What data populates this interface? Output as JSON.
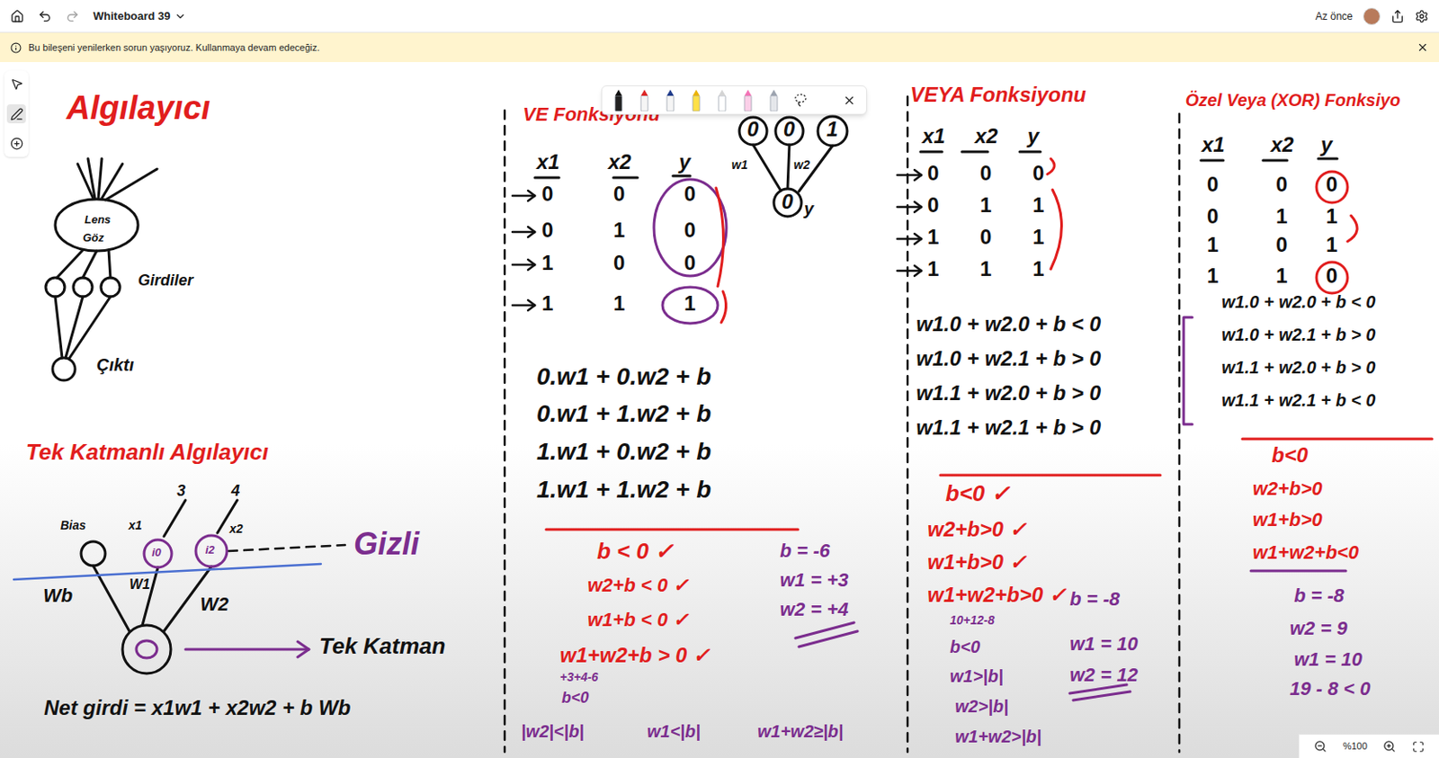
{
  "window": {
    "title": "Whiteboard 39",
    "status": "Az önce"
  },
  "banner": {
    "message": "Bu bileşeni yenilerken sorun yaşıyoruz. Kullanmaya devam edeceğiz."
  },
  "zoom": {
    "value": "%100"
  },
  "canvas": {
    "notes": [
      {
        "text": "Algılayıcı",
        "color": "#e11d1d"
      },
      {
        "text": "Lens",
        "color": "#111111"
      },
      {
        "text": "Göz",
        "color": "#111111"
      },
      {
        "text": "Girdiler",
        "color": "#111111"
      },
      {
        "text": "Çıktı",
        "color": "#111111"
      },
      {
        "text": "Tek Katmanlı Algılayıcı",
        "color": "#e11d1d"
      },
      {
        "text": "3",
        "color": "#111111"
      },
      {
        "text": "4",
        "color": "#111111"
      },
      {
        "text": "Bias",
        "color": "#111111"
      },
      {
        "text": "x1",
        "color": "#111111"
      },
      {
        "text": "x2",
        "color": "#111111"
      },
      {
        "text": "i0",
        "color": "#7b2d8e"
      },
      {
        "text": "i2",
        "color": "#7b2d8e"
      },
      {
        "text": "Gizli",
        "color": "#7b2d8e"
      },
      {
        "text": "Wb",
        "color": "#111111"
      },
      {
        "text": "W1",
        "color": "#111111"
      },
      {
        "text": "W2",
        "color": "#111111"
      },
      {
        "text": "Tek Katman",
        "color": "#111111"
      },
      {
        "text": "Net girdi = x1w1 + x2w2 + b Wb",
        "color": "#111111"
      },
      {
        "text": "VE Fonksiyonu",
        "color": "#e11d1d"
      },
      {
        "text": "0",
        "color": "#111111"
      },
      {
        "text": "0",
        "color": "#111111"
      },
      {
        "text": "1",
        "color": "#111111"
      },
      {
        "text": "w1",
        "color": "#111111"
      },
      {
        "text": "w2",
        "color": "#111111"
      },
      {
        "text": "0",
        "color": "#111111"
      },
      {
        "text": "y",
        "color": "#111111"
      },
      {
        "text": "0.w1 + 0.w2 + b",
        "color": "#111111"
      },
      {
        "text": "0.w1 + 1.w2 + b",
        "color": "#111111"
      },
      {
        "text": "1.w1 + 0.w2 + b",
        "color": "#111111"
      },
      {
        "text": "1.w1 + 1.w2 + b",
        "color": "#111111"
      },
      {
        "text": "b < 0 ✓",
        "color": "#e11d1d"
      },
      {
        "text": "w2+b < 0 ✓",
        "color": "#e11d1d"
      },
      {
        "text": "w1+b < 0 ✓",
        "color": "#e11d1d"
      },
      {
        "text": "w1+w2+b > 0 ✓",
        "color": "#e11d1d"
      },
      {
        "text": "+3+4-6",
        "color": "#7b2d8e"
      },
      {
        "text": "b<0",
        "color": "#7b2d8e"
      },
      {
        "text": "|w2|<|b|",
        "color": "#7b2d8e"
      },
      {
        "text": "w1<|b|",
        "color": "#7b2d8e"
      },
      {
        "text": "w1+w2≥|b|",
        "color": "#7b2d8e"
      },
      {
        "text": "b = -6",
        "color": "#7b2d8e"
      },
      {
        "text": "w1 = +3",
        "color": "#7b2d8e"
      },
      {
        "text": "w2 = +4",
        "color": "#7b2d8e"
      },
      {
        "text": "VEYA Fonksiyonu",
        "color": "#e11d1d"
      },
      {
        "text": "w1.0 + w2.0 + b < 0",
        "color": "#111111"
      },
      {
        "text": "w1.0 + w2.1 + b > 0",
        "color": "#111111"
      },
      {
        "text": "w1.1 + w2.0 + b > 0",
        "color": "#111111"
      },
      {
        "text": "w1.1 + w2.1 + b > 0",
        "color": "#111111"
      },
      {
        "text": "b<0 ✓",
        "color": "#e11d1d"
      },
      {
        "text": "w2+b>0 ✓",
        "color": "#e11d1d"
      },
      {
        "text": "w1+b>0 ✓",
        "color": "#e11d1d"
      },
      {
        "text": "w1+w2+b>0 ✓",
        "color": "#e11d1d"
      },
      {
        "text": "b = -8",
        "color": "#7b2d8e"
      },
      {
        "text": "10+12-8",
        "color": "#7b2d8e"
      },
      {
        "text": "b<0",
        "color": "#7b2d8e"
      },
      {
        "text": "w1>|b|",
        "color": "#7b2d8e"
      },
      {
        "text": "w2>|b|",
        "color": "#7b2d8e"
      },
      {
        "text": "w1+w2>|b|",
        "color": "#7b2d8e"
      },
      {
        "text": "w1 = 10",
        "color": "#7b2d8e"
      },
      {
        "text": "w2 = 12",
        "color": "#7b2d8e"
      },
      {
        "text": "Özel Veya (XOR) Fonksiyo",
        "color": "#e11d1d"
      },
      {
        "text": "w1.0 + w2.0 + b < 0",
        "color": "#111111"
      },
      {
        "text": "w1.0 + w2.1 + b > 0",
        "color": "#111111"
      },
      {
        "text": "w1.1 + w2.0 + b > 0",
        "color": "#111111"
      },
      {
        "text": "w1.1 + w2.1 + b < 0",
        "color": "#111111"
      },
      {
        "text": "b<0",
        "color": "#e11d1d"
      },
      {
        "text": "w2+b>0",
        "color": "#e11d1d"
      },
      {
        "text": "w1+b>0",
        "color": "#e11d1d"
      },
      {
        "text": "w1+w2+b<0",
        "color": "#e11d1d"
      },
      {
        "text": "b = -8",
        "color": "#7b2d8e"
      },
      {
        "text": "w2 = 9",
        "color": "#7b2d8e"
      },
      {
        "text": "w1 = 10",
        "color": "#7b2d8e"
      },
      {
        "text": "19 - 8 < 0",
        "color": "#7b2d8e"
      }
    ],
    "tables": [
      {
        "name": "VE",
        "headers": [
          "x1",
          "x2",
          "y"
        ],
        "rows": [
          [
            "0",
            "0",
            "0"
          ],
          [
            "0",
            "1",
            "0"
          ],
          [
            "1",
            "0",
            "0"
          ],
          [
            "1",
            "1",
            "1"
          ]
        ]
      },
      {
        "name": "VEYA",
        "headers": [
          "x1",
          "x2",
          "y"
        ],
        "rows": [
          [
            "0",
            "0",
            "0"
          ],
          [
            "0",
            "1",
            "1"
          ],
          [
            "1",
            "0",
            "1"
          ],
          [
            "1",
            "1",
            "1"
          ]
        ]
      },
      {
        "name": "XOR",
        "headers": [
          "x1",
          "x2",
          "y"
        ],
        "rows": [
          [
            "0",
            "0",
            "0"
          ],
          [
            "0",
            "1",
            "1"
          ],
          [
            "1",
            "0",
            "1"
          ],
          [
            "1",
            "1",
            "0"
          ]
        ]
      }
    ]
  }
}
